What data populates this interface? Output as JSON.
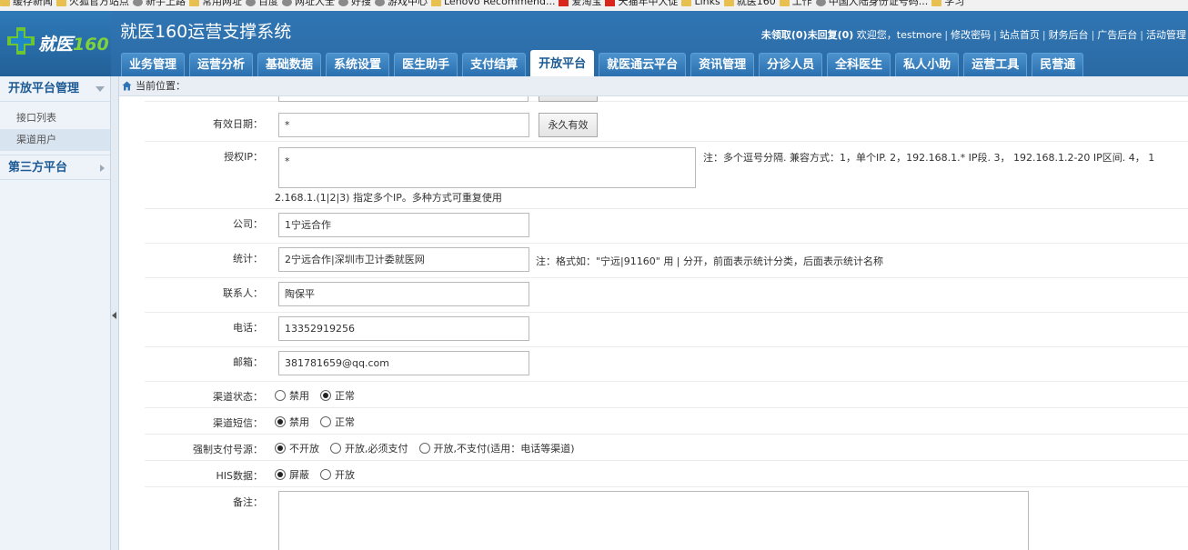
{
  "bookmarks": [
    {
      "icon": "folder",
      "label": "缓存新闻"
    },
    {
      "icon": "folder",
      "label": "火狐官方站点"
    },
    {
      "icon": "globe",
      "label": "新手上路"
    },
    {
      "icon": "folder",
      "label": "常用网址"
    },
    {
      "icon": "globe",
      "label": "百度"
    },
    {
      "icon": "globe",
      "label": "网址大全"
    },
    {
      "icon": "globe",
      "label": "好搜"
    },
    {
      "icon": "globe",
      "label": "游戏中心"
    },
    {
      "icon": "folder",
      "label": "Lenovo Recommend..."
    },
    {
      "icon": "red",
      "label": "爱淘宝"
    },
    {
      "icon": "red",
      "label": "天猫年中大促"
    },
    {
      "icon": "folder",
      "label": "Links"
    },
    {
      "icon": "folder",
      "label": "就医160"
    },
    {
      "icon": "folder",
      "label": "工作"
    },
    {
      "icon": "globe",
      "label": "中国大陆身份证号码..."
    },
    {
      "icon": "folder",
      "label": "学习"
    }
  ],
  "header": {
    "logo_main": "就医",
    "logo_num": "160",
    "title": "就医160运营支撑系统",
    "user_bar": {
      "messages": "未领取(0)未回复(0)",
      "welcome": "欢迎您，testmore",
      "links": [
        "修改密码",
        "站点首页",
        "财务后台",
        "广告后台",
        "活动管理"
      ]
    }
  },
  "nav": [
    {
      "label": "业务管理",
      "active": false
    },
    {
      "label": "运营分析",
      "active": false
    },
    {
      "label": "基础数据",
      "active": false
    },
    {
      "label": "系统设置",
      "active": false
    },
    {
      "label": "医生助手",
      "active": false
    },
    {
      "label": "支付结算",
      "active": false
    },
    {
      "label": "开放平台",
      "active": true
    },
    {
      "label": "就医通云平台",
      "active": false
    },
    {
      "label": "资讯管理",
      "active": false
    },
    {
      "label": "分诊人员",
      "active": false
    },
    {
      "label": "全科医生",
      "active": false
    },
    {
      "label": "私人小助",
      "active": false
    },
    {
      "label": "运营工具",
      "active": false
    },
    {
      "label": "民营通",
      "active": false
    }
  ],
  "sidebar": {
    "section1": "开放平台管理",
    "items": [
      "接口列表",
      "渠道用户"
    ],
    "active_item": "渠道用户",
    "section2": "第三方平台"
  },
  "breadcrumb": "当前位置：",
  "form": {
    "valid_date": {
      "label": "有效日期：",
      "value": "*",
      "button": "永久有效"
    },
    "auth_ip": {
      "label": "授权IP：",
      "value": "*",
      "note": "注：多个逗号分隔. 兼容方式：1，单个IP.  2，192.168.1.* IP段.  3， 192.168.1.2-20 IP区间.  4， 1",
      "note2": "2.168.1.(1|2|3) 指定多个IP。多种方式可重复使用"
    },
    "company": {
      "label": "公司：",
      "value": "1宁远合作"
    },
    "stats": {
      "label": "统计：",
      "value": "2宁远合作|深圳市卫计委就医网",
      "note": "注：格式如：\"宁远|91160\" 用 | 分开，前面表示统计分类，后面表示统计名称"
    },
    "contact": {
      "label": "联系人：",
      "value": "陶保平"
    },
    "phone": {
      "label": "电话：",
      "value": "13352919256"
    },
    "email": {
      "label": "邮箱：",
      "value": "381781659@qq.com"
    },
    "channel_status": {
      "label": "渠道状态：",
      "options": [
        "禁用",
        "正常"
      ],
      "selected": "正常"
    },
    "channel_sms": {
      "label": "渠道短信：",
      "options": [
        "禁用",
        "正常"
      ],
      "selected": "禁用"
    },
    "force_pay": {
      "label": "强制支付号源：",
      "options": [
        "不开放",
        "开放,必须支付",
        "开放,不支付(适用：电话等渠道)"
      ],
      "selected": "不开放"
    },
    "his_data": {
      "label": "HIS数据：",
      "options": [
        "屏蔽",
        "开放"
      ],
      "selected": "屏蔽"
    },
    "remark": {
      "label": "备注：",
      "value": ""
    }
  }
}
